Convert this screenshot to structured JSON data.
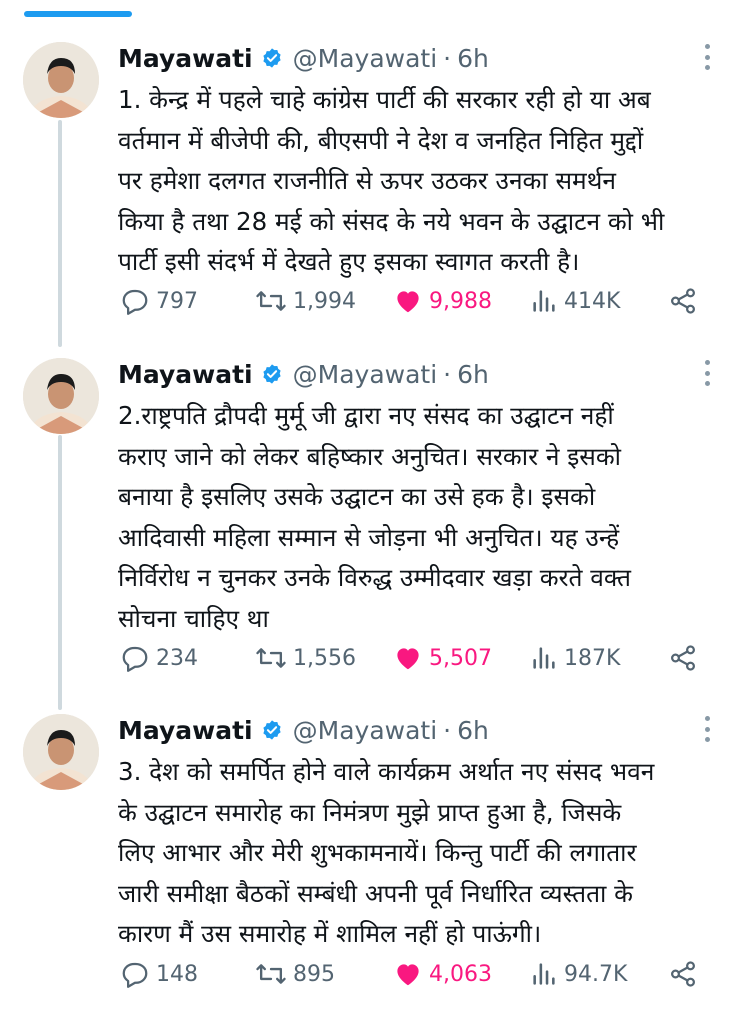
{
  "tweets": [
    {
      "name": "Mayawati",
      "handle": "@Mayawati",
      "separator": "·",
      "time": "6h",
      "text": "1. केन्द्र में पहले चाहे कांग्रेस पार्टी की सरकार रही हो या अब\nवर्तमान में बीजेपी की, बीएसपी ने देश व जनहित निहित मुद्दों\nपर हमेशा दलगत राजनीति से ऊपर उठकर उनका समर्थन\nकिया है तथा 28 मई को संसद के नये भवन के उद्घाटन को भी\nपार्टी इसी संदर्भ में देखते हुए इसका स्वागत करती है।",
      "replies": "797",
      "retweets": "1,994",
      "likes": "9,988",
      "views": "414K"
    },
    {
      "name": "Mayawati",
      "handle": "@Mayawati",
      "separator": "·",
      "time": "6h",
      "text": "2.राष्ट्रपति द्रौपदी मुर्मू जी द्वारा नए संसद का उद्घाटन नहीं\nकराए जाने को लेकर बहिष्कार अनुचित। सरकार ने इसको\nबनाया है इसलिए उसके उद्घाटन का उसे हक है। इसको\nआदिवासी महिला सम्मान से जोड़ना भी अनुचित। यह उन्हें\nनिर्विरोध न चुनकर उनके विरुद्ध उम्मीदवार खड़ा करते वक्त\nसोचना चाहिए था",
      "replies": "234",
      "retweets": "1,556",
      "likes": "5,507",
      "views": "187K"
    },
    {
      "name": "Mayawati",
      "handle": "@Mayawati",
      "separator": "·",
      "time": "6h",
      "text": "3. देश को समर्पित होने वाले कार्यक्रम अर्थात नए संसद भवन\nके उद्घाटन समारोह का निमंत्रण मुझे प्राप्त हुआ है, जिसके\nलिए आभार और मेरी शुभकामनायें। किन्तु पार्टी की लगातार\nजारी समीक्षा बैठकों सम्बंधी अपनी पूर्व निर्धारित व्यस्तता के\nकारण मैं उस समारोह में शामिल नहीं हो पाऊंगी।",
      "replies": "148",
      "retweets": "895",
      "likes": "4,063",
      "views": "94.7K"
    }
  ],
  "colors": {
    "accent": "#1d9bf0",
    "like": "#f91880",
    "muted": "#536471",
    "thread_line": "#cfd9de"
  },
  "icons": [
    "verified-badge-icon",
    "more-icon",
    "reply-icon",
    "retweet-icon",
    "heart-icon",
    "views-icon",
    "share-icon"
  ]
}
